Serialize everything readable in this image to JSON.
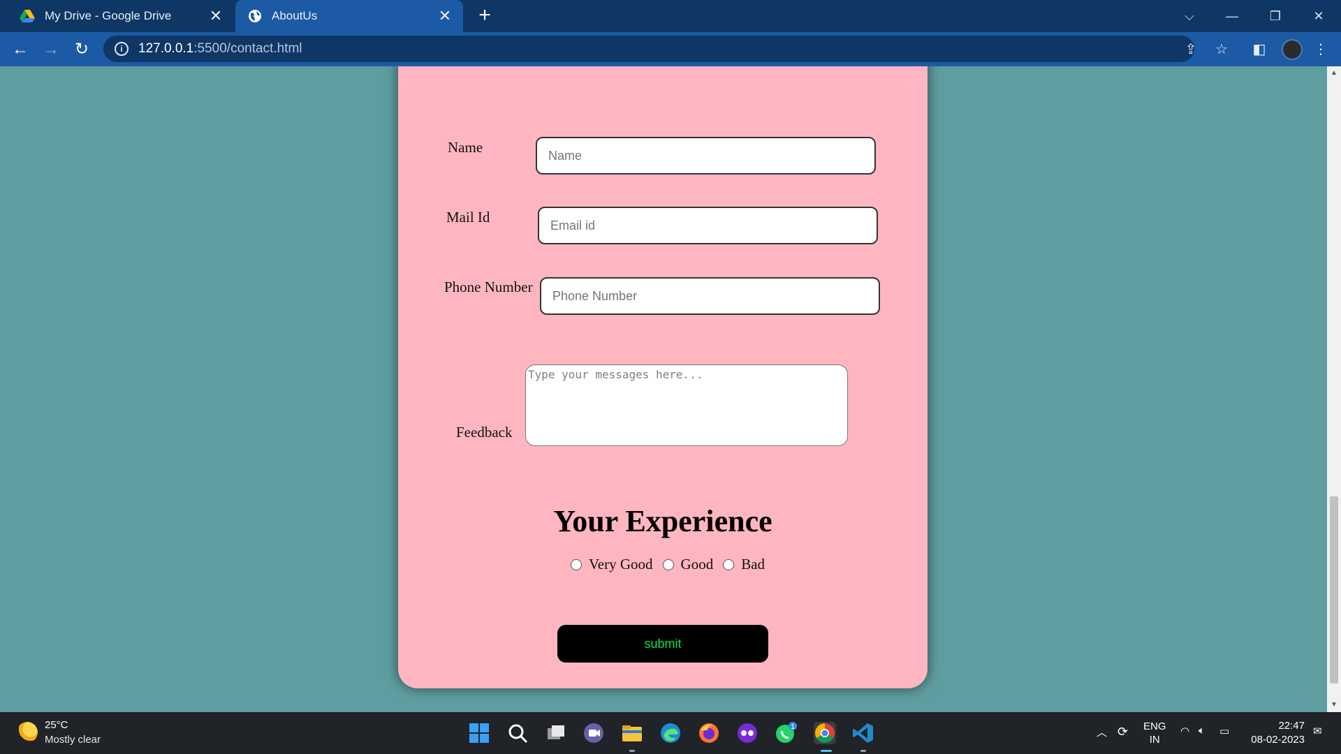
{
  "browser": {
    "tabs": [
      {
        "title": "My Drive - Google Drive",
        "icon": "google-drive-icon",
        "active": false
      },
      {
        "title": "AboutUs",
        "icon": "globe-icon",
        "active": true
      }
    ],
    "new_tab": "+",
    "url_host": "127.0.0.1",
    "url_rest": ":5500/contact.html"
  },
  "form": {
    "name_label": "Name",
    "name_placeholder": "Name",
    "mail_label": "Mail Id",
    "mail_placeholder": "Email id",
    "phone_label": "Phone Number",
    "phone_placeholder": "Phone Number",
    "feedback_label": "Feedback",
    "feedback_placeholder": "Type your messages here...",
    "experience_title": "Your Experience",
    "options": [
      "Very Good",
      "Good",
      "Bad"
    ],
    "submit_label": "submit"
  },
  "taskbar": {
    "temperature": "25°C",
    "weather": "Mostly clear",
    "lang": "ENG",
    "region": "IN",
    "time": "22:47",
    "date": "08-02-2023",
    "whatsapp_badge": "1"
  },
  "colors": {
    "page_bg": "#5f9ea0",
    "card_bg": "#ffb6c1",
    "submit_bg": "#000000",
    "submit_text": "#00e64d",
    "chrome_dark": "#0e3766",
    "chrome_light": "#1c5aa6"
  }
}
